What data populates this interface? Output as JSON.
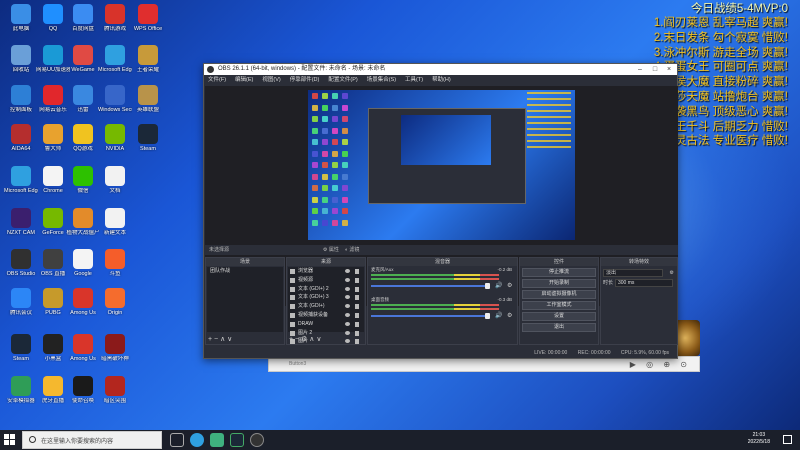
{
  "desktop": {
    "icons": [
      {
        "label": "此电脑",
        "color": "#3a8ee6"
      },
      {
        "label": "QQ",
        "color": "#1f8fff"
      },
      {
        "label": "百度网盘",
        "color": "#3b8cf2"
      },
      {
        "label": "腾讯游戏",
        "color": "#d8332a"
      },
      {
        "label": "WPS Office",
        "color": "#e02e2e"
      },
      {
        "label": "回收站",
        "color": "#6a9fd8"
      },
      {
        "label": "网易UU加速器",
        "color": "#1a9ad6"
      },
      {
        "label": "WeGame",
        "color": "#e04a44"
      },
      {
        "label": "Microsoft Edge",
        "color": "#2fa0e0"
      },
      {
        "label": "王者荣耀",
        "color": "#c79a3a"
      },
      {
        "label": "控制面板",
        "color": "#2d7fd6"
      },
      {
        "label": "网易云音乐",
        "color": "#e1272c"
      },
      {
        "label": "迅雷",
        "color": "#3a88e0"
      },
      {
        "label": "Windows Security",
        "color": "#3766c9"
      },
      {
        "label": "英雄联盟",
        "color": "#b8934a"
      },
      {
        "label": "AIDA64",
        "color": "#b52e2e"
      },
      {
        "label": "鲁大师",
        "color": "#e8a22e"
      },
      {
        "label": "QQ游戏",
        "color": "#f0c320"
      },
      {
        "label": "NVIDIA",
        "color": "#76b900"
      },
      {
        "label": "Steam",
        "color": "#1b2838"
      },
      {
        "label": "Microsoft Edge",
        "color": "#2fa0e0"
      },
      {
        "label": "Chrome",
        "color": "#f4f4f4"
      },
      {
        "label": "微信",
        "color": "#2dc100"
      },
      {
        "label": "文档",
        "color": "#f2f2f2"
      },
      {
        "label": "NZXT CAM",
        "color": "#3b1f6e"
      },
      {
        "label": "GeForce",
        "color": "#76b900"
      },
      {
        "label": "植物大战僵尸",
        "color": "#e38b2a"
      },
      {
        "label": "新建文本",
        "color": "#f2f2f2"
      },
      {
        "label": "OBS Studio",
        "color": "#303030"
      },
      {
        "label": "OBS 直播",
        "color": "#404040"
      },
      {
        "label": "Google",
        "color": "#f4f4f4"
      },
      {
        "label": "斗鱼",
        "color": "#f55d2a"
      },
      {
        "label": "腾讯会议",
        "color": "#2c86f6"
      },
      {
        "label": "PUBG",
        "color": "#c69a2b"
      },
      {
        "label": "Among Us",
        "color": "#d9352a"
      },
      {
        "label": "Origin",
        "color": "#f56c2d"
      },
      {
        "label": "Steam",
        "color": "#1b2838"
      },
      {
        "label": "小黑盒",
        "color": "#222222"
      },
      {
        "label": "Among Us",
        "color": "#d9352a"
      },
      {
        "label": "暗黑破坏神",
        "color": "#8b1a1a"
      },
      {
        "label": "安卓模拟器",
        "color": "#2f9d57"
      },
      {
        "label": "虎牙直播",
        "color": "#f5b82e"
      },
      {
        "label": "使命召唤",
        "color": "#1a1a1a"
      },
      {
        "label": "暗区突围",
        "color": "#b3261e"
      }
    ]
  },
  "overlay": {
    "title": "今日战绩5-4MVP:0",
    "lines": [
      "1.阎刃莱恩 乱宰马超 爽赢!",
      "2.末日发条 勾个寂寞 惜败!",
      "3.泳冲尔斯 游走全场 爽赢!",
      "4.蛋蛋女王 可圈可点 爽赢!",
      "5.夏侯大魔 直接粉碎 爽赢!",
      "6.温莎天魔 站撸炮台 爽赢!",
      "7.突袭黑鸟 顶级恶心 爽赢!",
      "8.龙王千斗 后期乏力 惜败!",
      "9.恶灵古法 专业医疗 惜败!"
    ]
  },
  "obs": {
    "title": "OBS 26.1.1 (64-bit, windows) - 配置文件: 未命名 - 场景: 未命名",
    "menu": [
      "文件(F)",
      "编辑(E)",
      "视图(V)",
      "停靠部件(D)",
      "配置文件(P)",
      "场景集合(S)",
      "工具(T)",
      "帮助(H)"
    ],
    "toolbar": {
      "label": "未选择源",
      "properties": "属性",
      "filters": "滤镜"
    },
    "docks": {
      "scenes": {
        "title": "场景",
        "items": [
          "团队作战"
        ]
      },
      "sources": {
        "title": "来源",
        "items": [
          "浏览器",
          "视频源",
          "文本 (GDI+) 2",
          "文本 (GDI+) 3",
          "文本 (GDI+)",
          "视频捕获设备",
          "DRAW",
          "图片 2",
          "图片"
        ]
      },
      "mixer": {
        "title": "混音器",
        "channels": [
          {
            "name": "麦克风/Aux",
            "db": "-0.2 dB"
          },
          {
            "name": "桌面音频",
            "db": "-0.3 dB"
          }
        ]
      },
      "controls": {
        "title": "控件",
        "buttons": [
          "停止推流",
          "开始录制",
          "启动虚拟摄像机",
          "工作室模式",
          "设置",
          "退出"
        ]
      },
      "transitions": {
        "title": "转场特效",
        "type": "淡出",
        "duration_label": "时长",
        "duration": "300 ms"
      }
    },
    "status": {
      "live": "LIVE: 00:00:00",
      "rec": "REC: 00:00:00",
      "cpu": "CPU: 5.9%, 60.00 fps"
    }
  },
  "background_window": {
    "text": "Button3"
  },
  "taskbar": {
    "search_placeholder": "在这里输入你要搜索的内容",
    "time": "21:03",
    "date": "2022/5/18"
  }
}
